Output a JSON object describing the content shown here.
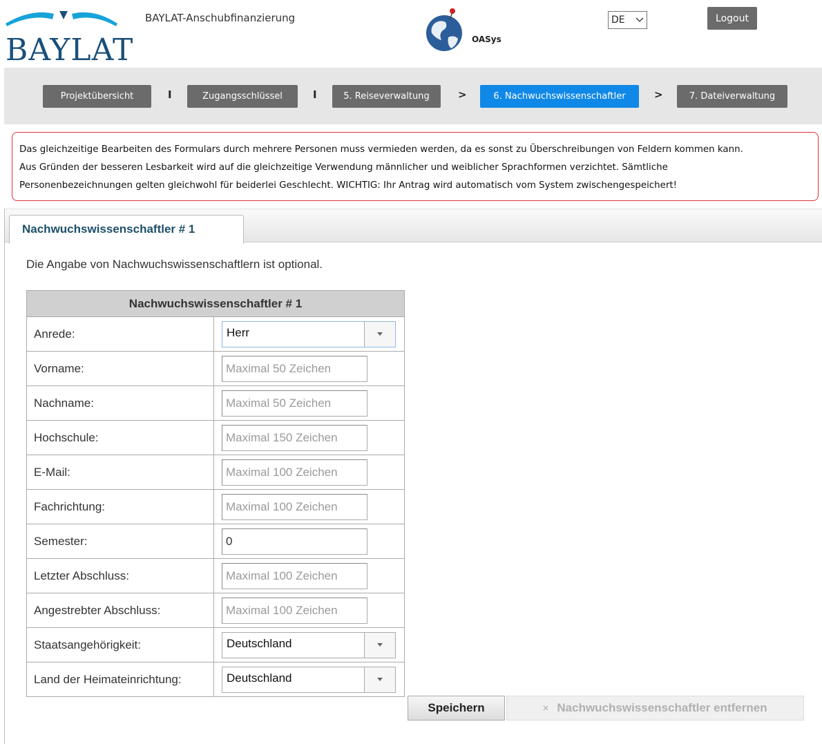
{
  "header": {
    "logo_text": "BAYLAT",
    "app_title": "BAYLAT-Anschubfinanzierung",
    "oasys_logo_text": "OASys",
    "language": "DE",
    "logout_label": "Logout"
  },
  "steps": [
    {
      "label": "Projektübersicht"
    },
    {
      "label": "Zugangsschlüssel"
    },
    {
      "label": "5. Reiseverwaltung"
    },
    {
      "label": "6. Nachwuchswissenschaftler",
      "active": true
    },
    {
      "label": "7. Dateiverwaltung"
    }
  ],
  "separators": [
    "I",
    "I",
    ">",
    ">"
  ],
  "notice": {
    "lines": [
      "Das gleichzeitige Bearbeiten des Formulars durch mehrere Personen muss vermieden werden, da es sonst zu Überschreibungen von Feldern kommen kann.",
      "Aus Gründen der besseren Lesbarkeit wird auf die gleichzeitige Verwendung männlicher und weiblicher Sprachformen verzichtet. Sämtliche",
      "Personenbezeichnungen gelten gleichwohl für beiderlei Geschlecht. WICHTIG: Ihr Antrag wird automatisch vom System zwischengespeichert!"
    ]
  },
  "tab": {
    "label": "Nachwuchswissenschaftler # 1"
  },
  "intro": "Die Angabe von Nachwuchswissenschaftlern ist optional.",
  "form": {
    "header": "Nachwuchswissenschaftler # 1",
    "fields": {
      "anrede": {
        "label": "Anrede:",
        "value": "Herr"
      },
      "vorname": {
        "label": "Vorname:",
        "placeholder": "Maximal 50 Zeichen"
      },
      "nachname": {
        "label": "Nachname:",
        "placeholder": "Maximal 50 Zeichen"
      },
      "hochschule": {
        "label": "Hochschule:",
        "placeholder": "Maximal 150 Zeichen"
      },
      "email": {
        "label": "E-Mail:",
        "placeholder": "Maximal 100 Zeichen"
      },
      "fachrichtung": {
        "label": "Fachrichtung:",
        "placeholder": "Maximal 100 Zeichen"
      },
      "semester": {
        "label": "Semester:",
        "value": "0"
      },
      "letzter_abschluss": {
        "label": "Letzter Abschluss:",
        "placeholder": "Maximal 100 Zeichen"
      },
      "angestrebter_abschluss": {
        "label": "Angestrebter Abschluss:",
        "placeholder": "Maximal 100 Zeichen"
      },
      "staatsangehoerigkeit": {
        "label": "Staatsangehörigkeit:",
        "value": "Deutschland"
      },
      "land_heimateinrichtung": {
        "label": "Land der Heimateinrichtung:",
        "value": "Deutschland"
      }
    }
  },
  "buttons": {
    "save_label": "Speichern",
    "remove_label": "Nachwuchswissenschaftler entfernen"
  },
  "colors": {
    "step_default": "#6b6b6b",
    "step_active": "#1088e8",
    "notice_border": "#dd3333",
    "logo_blue": "#1a4f7a"
  }
}
